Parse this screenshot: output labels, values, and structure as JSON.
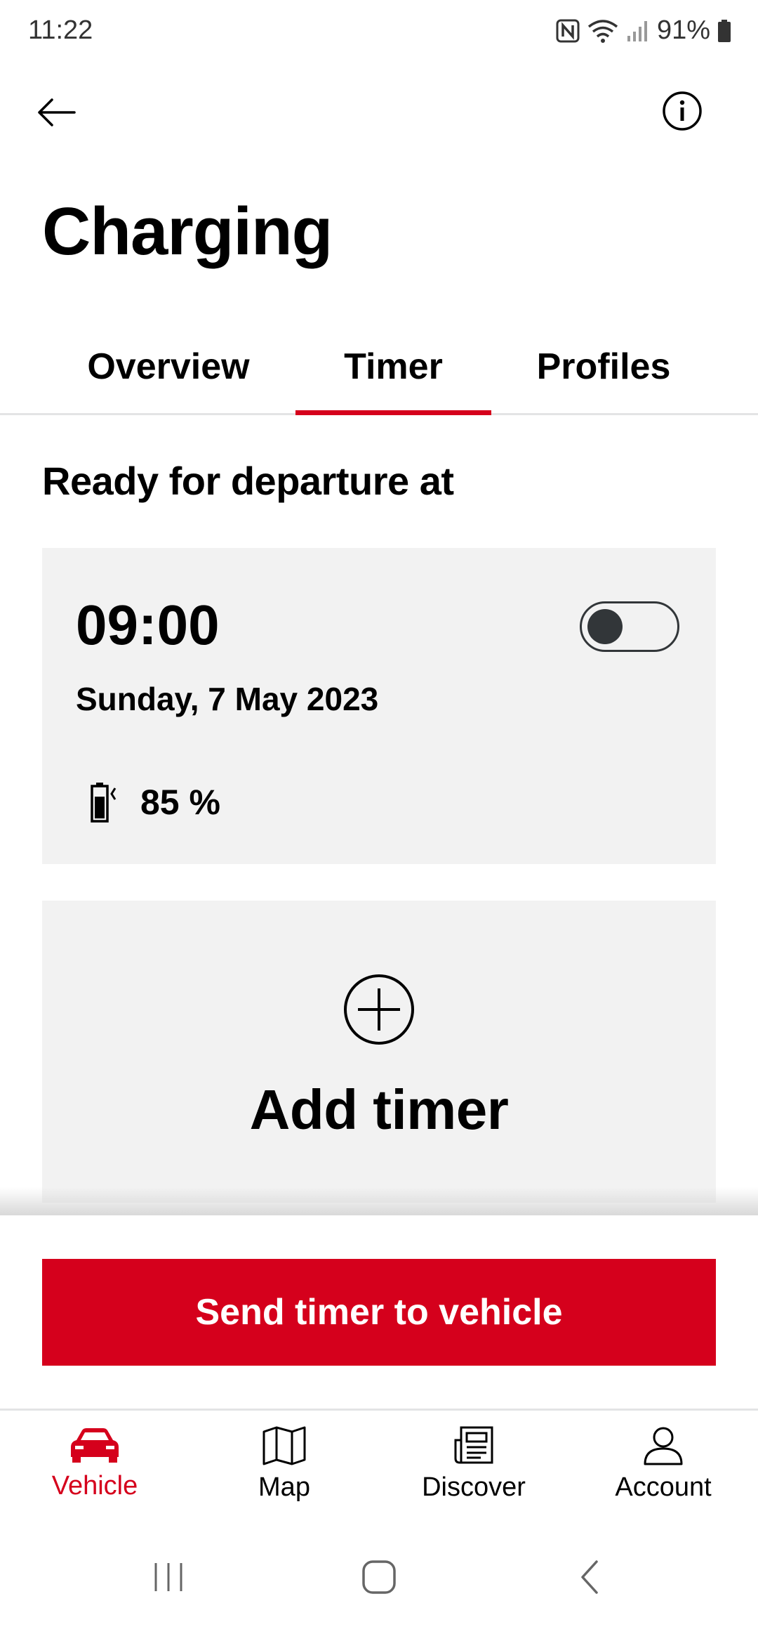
{
  "status_bar": {
    "time": "11:22",
    "battery": "91%"
  },
  "header": {
    "title": "Charging"
  },
  "tabs": [
    {
      "label": "Overview",
      "active": false
    },
    {
      "label": "Timer",
      "active": true
    },
    {
      "label": "Profiles",
      "active": false
    }
  ],
  "section": {
    "heading": "Ready for departure at"
  },
  "timer": {
    "time": "09:00",
    "date": "Sunday, 7 May 2023",
    "target_charge": "85 %",
    "enabled": false
  },
  "add_timer": {
    "label": "Add timer"
  },
  "send_button": {
    "label": "Send timer to vehicle"
  },
  "bottom_nav": [
    {
      "label": "Vehicle",
      "icon": "car-icon",
      "active": true
    },
    {
      "label": "Map",
      "icon": "map-icon",
      "active": false
    },
    {
      "label": "Discover",
      "icon": "news-icon",
      "active": false
    },
    {
      "label": "Account",
      "icon": "user-icon",
      "active": false
    }
  ],
  "colors": {
    "accent": "#d5001c",
    "card_bg": "#f2f2f2",
    "toggle": "#323639"
  }
}
